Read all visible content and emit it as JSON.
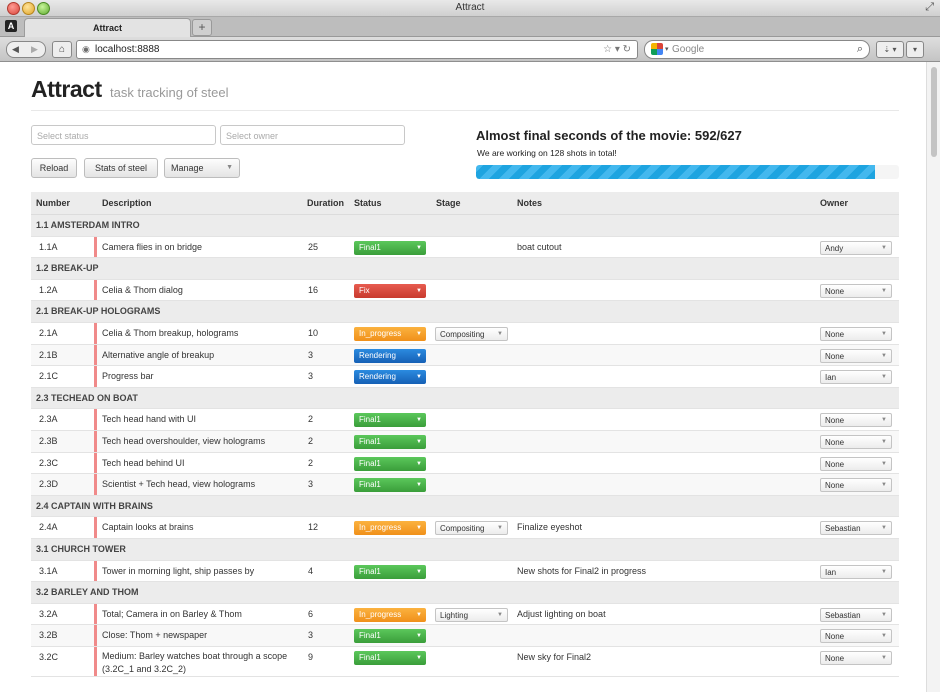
{
  "window": {
    "title": "Attract"
  },
  "tabs": [
    {
      "label": "Attract"
    }
  ],
  "toolbar": {
    "url": "localhost:8888",
    "search_placeholder": "Google"
  },
  "header": {
    "title": "Attract",
    "subtitle": "task tracking of steel"
  },
  "filters": {
    "status_placeholder": "Select status",
    "owner_placeholder": "Select owner"
  },
  "buttons": {
    "reload": "Reload",
    "stats": "Stats of steel",
    "manage": "Manage"
  },
  "progress": {
    "title": "Almost final seconds of the movie: 592/627",
    "subtitle": "We are working on 128 shots in total!",
    "fraction": 0.944
  },
  "table": {
    "columns": [
      "Number",
      "Description",
      "Duration",
      "Status",
      "Stage",
      "Notes",
      "Owner"
    ]
  },
  "rows": [
    {
      "group": "1.1 AMSTERDAM INTRO"
    },
    {
      "number": "1.1A",
      "description": "Camera flies in on bridge",
      "duration": "25",
      "status": "Final1",
      "status_type": "final",
      "stage": "",
      "notes": "boat cutout",
      "owner": "Andy"
    },
    {
      "group": "1.2 BREAK-UP"
    },
    {
      "number": "1.2A",
      "description": "Celia & Thom dialog",
      "duration": "16",
      "status": "Fix",
      "status_type": "fix",
      "stage": "",
      "notes": "",
      "owner": "None"
    },
    {
      "group": "2.1 BREAK-UP HOLOGRAMS"
    },
    {
      "number": "2.1A",
      "description": "Celia & Thom breakup, holograms",
      "duration": "10",
      "status": "In_progress",
      "status_type": "prog",
      "stage": "Compositing",
      "notes": "",
      "owner": "None"
    },
    {
      "number": "2.1B",
      "description": "Alternative angle of breakup",
      "duration": "3",
      "status": "Rendering",
      "status_type": "rend",
      "stage": "",
      "notes": "",
      "owner": "None"
    },
    {
      "number": "2.1C",
      "description": "Progress bar",
      "duration": "3",
      "status": "Rendering",
      "status_type": "rend",
      "stage": "",
      "notes": "",
      "owner": "Ian"
    },
    {
      "group": "2.3 TECHEAD ON BOAT"
    },
    {
      "number": "2.3A",
      "description": "Tech head hand with UI",
      "duration": "2",
      "status": "Final1",
      "status_type": "final",
      "stage": "",
      "notes": "",
      "owner": "None"
    },
    {
      "number": "2.3B",
      "description": "Tech head overshoulder, view holograms",
      "duration": "2",
      "status": "Final1",
      "status_type": "final",
      "stage": "",
      "notes": "",
      "owner": "None"
    },
    {
      "number": "2.3C",
      "description": "Tech head behind UI",
      "duration": "2",
      "status": "Final1",
      "status_type": "final",
      "stage": "",
      "notes": "",
      "owner": "None"
    },
    {
      "number": "2.3D",
      "description": "Scientist + Tech head, view holograms",
      "duration": "3",
      "status": "Final1",
      "status_type": "final",
      "stage": "",
      "notes": "",
      "owner": "None"
    },
    {
      "group": "2.4 CAPTAIN WITH BRAINS"
    },
    {
      "number": "2.4A",
      "description": "Captain looks at brains",
      "duration": "12",
      "status": "In_progress",
      "status_type": "prog",
      "stage": "Compositing",
      "notes": "Finalize eyeshot",
      "owner": "Sebastian"
    },
    {
      "group": "3.1 CHURCH TOWER"
    },
    {
      "number": "3.1A",
      "description": "Tower in morning light, ship passes by",
      "duration": "4",
      "status": "Final1",
      "status_type": "final",
      "stage": "",
      "notes": "New shots for Final2 in progress",
      "owner": "Ian"
    },
    {
      "group": "3.2 BARLEY AND THOM"
    },
    {
      "number": "3.2A",
      "description": "Total; Camera in on Barley & Thom",
      "duration": "6",
      "status": "In_progress",
      "status_type": "prog",
      "stage": "Lighting",
      "notes": "Adjust lighting on boat",
      "owner": "Sebastian"
    },
    {
      "number": "3.2B",
      "description": "Close: Thom + newspaper",
      "duration": "3",
      "status": "Final1",
      "status_type": "final",
      "stage": "",
      "notes": "",
      "owner": "None"
    },
    {
      "number": "3.2C",
      "description": "Medium: Barley watches boat through a scope (3.2C_1 and 3.2C_2)",
      "duration": "9",
      "status": "Final1",
      "status_type": "final",
      "stage": "",
      "notes": "New sky for Final2",
      "owner": "None"
    }
  ]
}
